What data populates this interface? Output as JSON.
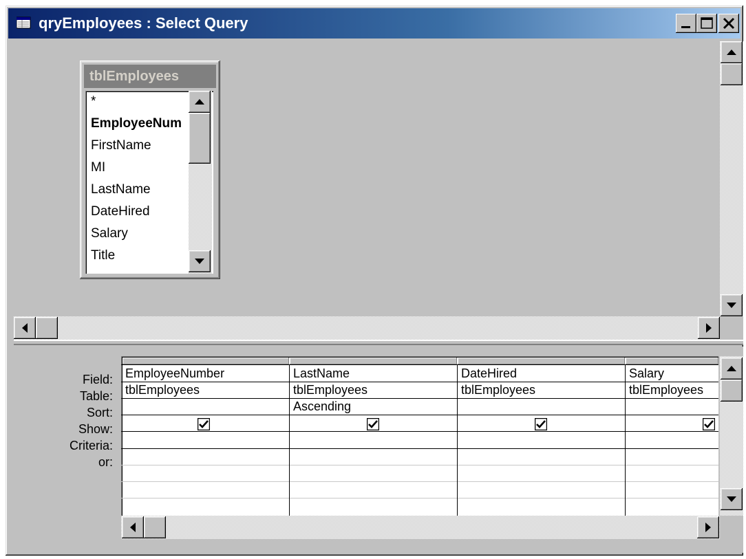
{
  "window": {
    "title": "qryEmployees : Select Query",
    "minimize": "minimize-icon",
    "maximize": "maximize-icon",
    "close": "close-icon"
  },
  "table": {
    "name": "tblEmployees",
    "fields": [
      "*",
      "EmployeeNum",
      "FirstName",
      "MI",
      "LastName",
      "DateHired",
      "Salary",
      "Title"
    ],
    "primary_key": "EmployeeNum"
  },
  "grid": {
    "row_labels": [
      "Field:",
      "Table:",
      "Sort:",
      "Show:",
      "Criteria:",
      "or:"
    ],
    "columns": [
      {
        "field": "EmployeeNumber",
        "table": "tblEmployees",
        "sort": "",
        "show": true
      },
      {
        "field": "LastName",
        "table": "tblEmployees",
        "sort": "Ascending",
        "show": true
      },
      {
        "field": "DateHired",
        "table": "tblEmployees",
        "sort": "",
        "show": true
      },
      {
        "field": "Salary",
        "table": "tblEmployees",
        "sort": "",
        "show": true
      }
    ]
  },
  "colors": {
    "title_start": "#0a246a",
    "title_end": "#a6caf0",
    "face": "#c0c0c0"
  }
}
